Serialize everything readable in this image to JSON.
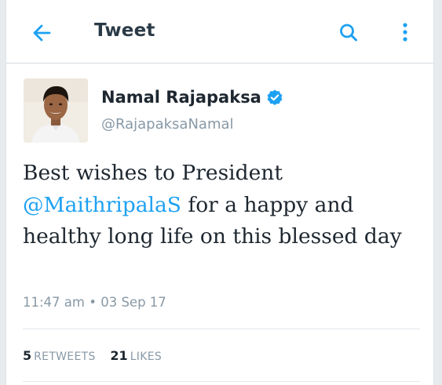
{
  "header": {
    "title": "Tweet",
    "back_icon": "arrow-left-icon",
    "search_icon": "search-icon",
    "more_icon": "more-vertical-icon",
    "accent_color": "#1da1f2"
  },
  "tweet": {
    "author_name": "Namal Rajapaksa",
    "verified": true,
    "verified_icon": "verified-badge-icon",
    "handle": "@RajapaksaNamal",
    "text_before": "Best wishes to President ",
    "mention": "@MaithripalaS",
    "text_after": " for a happy and healthy long life on this blessed day",
    "timestamp": "11:47 am • 03 Sep 17",
    "retweets_count": "5",
    "retweets_label": "RETWEETS",
    "likes_count": "21",
    "likes_label": "LIKES"
  }
}
